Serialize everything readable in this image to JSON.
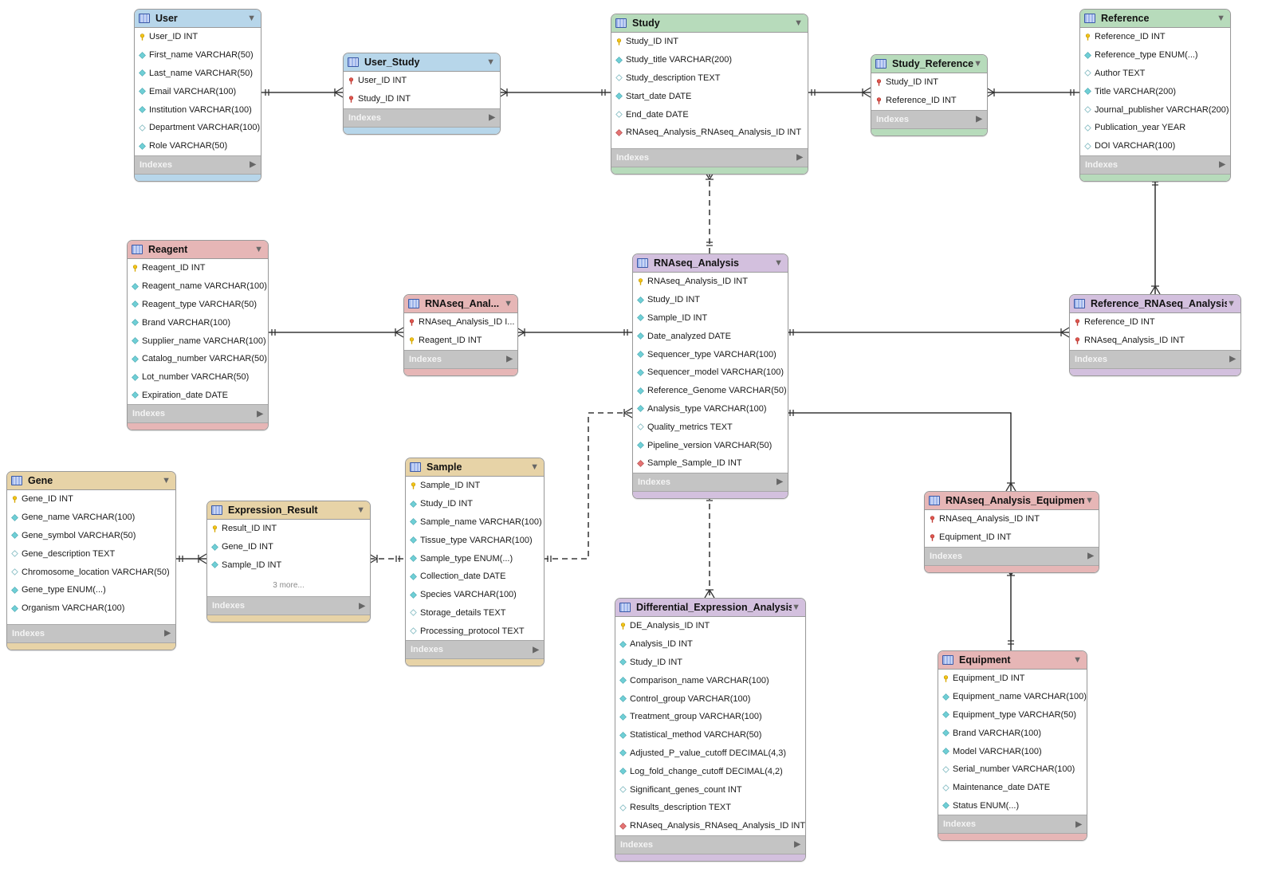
{
  "diagram": {
    "indexes_label": "Indexes",
    "colors": {
      "blue": "#b7d6ea",
      "green": "#b7dbbb",
      "red": "#e6b6b6",
      "purple": "#d3c0de",
      "tan": "#e7d3a7",
      "pk_key": "#f2c417",
      "fk_key": "#d9534f",
      "column_diamond": "#6fcfd6",
      "fk_diamond": "#e57373"
    },
    "tables": [
      {
        "id": "user",
        "name": "User",
        "color": "blue",
        "columns": [
          {
            "label": "User_ID INT",
            "icon": "primary-key"
          },
          {
            "label": "First_name VARCHAR(50)",
            "icon": "not-null-column"
          },
          {
            "label": "Last_name VARCHAR(50)",
            "icon": "not-null-column"
          },
          {
            "label": "Email VARCHAR(100)",
            "icon": "not-null-column"
          },
          {
            "label": "Institution VARCHAR(100)",
            "icon": "not-null-column"
          },
          {
            "label": "Department VARCHAR(100)",
            "icon": "nullable-column"
          },
          {
            "label": "Role VARCHAR(50)",
            "icon": "not-null-column"
          }
        ]
      },
      {
        "id": "user_study",
        "name": "User_Study",
        "color": "blue",
        "columns": [
          {
            "label": "User_ID INT",
            "icon": "foreign-primary-key"
          },
          {
            "label": "Study_ID INT",
            "icon": "foreign-primary-key"
          }
        ]
      },
      {
        "id": "study",
        "name": "Study",
        "color": "green",
        "columns": [
          {
            "label": "Study_ID INT",
            "icon": "primary-key"
          },
          {
            "label": "Study_title VARCHAR(200)",
            "icon": "not-null-column"
          },
          {
            "label": "Study_description TEXT",
            "icon": "nullable-column"
          },
          {
            "label": "Start_date DATE",
            "icon": "not-null-column"
          },
          {
            "label": "End_date DATE",
            "icon": "nullable-column"
          },
          {
            "label": "RNAseq_Analysis_RNAseq_Analysis_ID INT",
            "icon": "foreign-key-column"
          }
        ]
      },
      {
        "id": "study_reference",
        "name": "Study_Reference",
        "color": "green",
        "columns": [
          {
            "label": "Study_ID INT",
            "icon": "foreign-primary-key"
          },
          {
            "label": "Reference_ID INT",
            "icon": "foreign-primary-key"
          }
        ]
      },
      {
        "id": "reference",
        "name": "Reference",
        "color": "green",
        "columns": [
          {
            "label": "Reference_ID INT",
            "icon": "primary-key"
          },
          {
            "label": "Reference_type ENUM(...)",
            "icon": "not-null-column"
          },
          {
            "label": "Author TEXT",
            "icon": "nullable-column"
          },
          {
            "label": "Title VARCHAR(200)",
            "icon": "not-null-column"
          },
          {
            "label": "Journal_publisher VARCHAR(200)",
            "icon": "nullable-column"
          },
          {
            "label": "Publication_year YEAR",
            "icon": "nullable-column"
          },
          {
            "label": "DOI VARCHAR(100)",
            "icon": "nullable-column"
          }
        ]
      },
      {
        "id": "reagent",
        "name": "Reagent",
        "color": "red",
        "columns": [
          {
            "label": "Reagent_ID INT",
            "icon": "primary-key"
          },
          {
            "label": "Reagent_name VARCHAR(100)",
            "icon": "not-null-column"
          },
          {
            "label": "Reagent_type VARCHAR(50)",
            "icon": "not-null-column"
          },
          {
            "label": "Brand VARCHAR(100)",
            "icon": "not-null-column"
          },
          {
            "label": "Supplier_name VARCHAR(100)",
            "icon": "not-null-column"
          },
          {
            "label": "Catalog_number VARCHAR(50)",
            "icon": "not-null-column"
          },
          {
            "label": "Lot_number VARCHAR(50)",
            "icon": "not-null-column"
          },
          {
            "label": "Expiration_date DATE",
            "icon": "not-null-column"
          }
        ]
      },
      {
        "id": "rnaseq_reagent",
        "name": "RNAseq_Anal...",
        "color": "red",
        "columns": [
          {
            "label": "RNAseq_Analysis_ID I...",
            "icon": "foreign-primary-key"
          },
          {
            "label": "Reagent_ID INT",
            "icon": "primary-key"
          }
        ]
      },
      {
        "id": "rnaseq_analysis",
        "name": "RNAseq_Analysis",
        "color": "purple",
        "columns": [
          {
            "label": "RNAseq_Analysis_ID INT",
            "icon": "primary-key"
          },
          {
            "label": "Study_ID INT",
            "icon": "not-null-column"
          },
          {
            "label": "Sample_ID INT",
            "icon": "not-null-column"
          },
          {
            "label": "Date_analyzed DATE",
            "icon": "not-null-column"
          },
          {
            "label": "Sequencer_type VARCHAR(100)",
            "icon": "not-null-column"
          },
          {
            "label": "Sequencer_model VARCHAR(100)",
            "icon": "not-null-column"
          },
          {
            "label": "Reference_Genome VARCHAR(50)",
            "icon": "not-null-column"
          },
          {
            "label": "Analysis_type VARCHAR(100)",
            "icon": "not-null-column"
          },
          {
            "label": "Quality_metrics TEXT",
            "icon": "nullable-column"
          },
          {
            "label": "Pipeline_version VARCHAR(50)",
            "icon": "not-null-column"
          },
          {
            "label": "Sample_Sample_ID INT",
            "icon": "foreign-key-column"
          }
        ]
      },
      {
        "id": "reference_rnaseq",
        "name": "Reference_RNAseq_Analysis",
        "color": "purple",
        "columns": [
          {
            "label": "Reference_ID INT",
            "icon": "foreign-primary-key"
          },
          {
            "label": "RNAseq_Analysis_ID INT",
            "icon": "foreign-primary-key"
          }
        ]
      },
      {
        "id": "gene",
        "name": "Gene",
        "color": "tan",
        "columns": [
          {
            "label": "Gene_ID INT",
            "icon": "primary-key"
          },
          {
            "label": "Gene_name VARCHAR(100)",
            "icon": "not-null-column"
          },
          {
            "label": "Gene_symbol VARCHAR(50)",
            "icon": "not-null-column"
          },
          {
            "label": "Gene_description TEXT",
            "icon": "nullable-column"
          },
          {
            "label": "Chromosome_location VARCHAR(50)",
            "icon": "nullable-column"
          },
          {
            "label": "Gene_type ENUM(...)",
            "icon": "not-null-column"
          },
          {
            "label": "Organism VARCHAR(100)",
            "icon": "not-null-column"
          }
        ]
      },
      {
        "id": "expression_result",
        "name": "Expression_Result",
        "color": "tan",
        "more": "3 more...",
        "columns": [
          {
            "label": "Result_ID INT",
            "icon": "primary-key"
          },
          {
            "label": "Gene_ID INT",
            "icon": "not-null-column"
          },
          {
            "label": "Sample_ID INT",
            "icon": "not-null-column"
          }
        ]
      },
      {
        "id": "sample",
        "name": "Sample",
        "color": "tan",
        "columns": [
          {
            "label": "Sample_ID INT",
            "icon": "primary-key"
          },
          {
            "label": "Study_ID INT",
            "icon": "not-null-column"
          },
          {
            "label": "Sample_name VARCHAR(100)",
            "icon": "not-null-column"
          },
          {
            "label": "Tissue_type VARCHAR(100)",
            "icon": "not-null-column"
          },
          {
            "label": "Sample_type ENUM(...)",
            "icon": "not-null-column"
          },
          {
            "label": "Collection_date DATE",
            "icon": "not-null-column"
          },
          {
            "label": "Species VARCHAR(100)",
            "icon": "not-null-column"
          },
          {
            "label": "Storage_details TEXT",
            "icon": "nullable-column"
          },
          {
            "label": "Processing_protocol TEXT",
            "icon": "nullable-column"
          }
        ]
      },
      {
        "id": "de_analysis",
        "name": "Differential_Expression_Analysis",
        "color": "purple",
        "columns": [
          {
            "label": "DE_Analysis_ID INT",
            "icon": "primary-key"
          },
          {
            "label": "Analysis_ID INT",
            "icon": "not-null-column"
          },
          {
            "label": "Study_ID INT",
            "icon": "not-null-column"
          },
          {
            "label": "Comparison_name VARCHAR(100)",
            "icon": "not-null-column"
          },
          {
            "label": "Control_group VARCHAR(100)",
            "icon": "not-null-column"
          },
          {
            "label": "Treatment_group VARCHAR(100)",
            "icon": "not-null-column"
          },
          {
            "label": "Statistical_method VARCHAR(50)",
            "icon": "not-null-column"
          },
          {
            "label": "Adjusted_P_value_cutoff DECIMAL(4,3)",
            "icon": "not-null-column"
          },
          {
            "label": "Log_fold_change_cutoff DECIMAL(4,2)",
            "icon": "not-null-column"
          },
          {
            "label": "Significant_genes_count INT",
            "icon": "nullable-column"
          },
          {
            "label": "Results_description TEXT",
            "icon": "nullable-column"
          },
          {
            "label": "RNAseq_Analysis_RNAseq_Analysis_ID INT",
            "icon": "foreign-key-column"
          }
        ]
      },
      {
        "id": "rnaseq_equipment",
        "name": "RNAseq_Analysis_Equipment",
        "color": "red",
        "columns": [
          {
            "label": "RNAseq_Analysis_ID INT",
            "icon": "foreign-primary-key"
          },
          {
            "label": "Equipment_ID INT",
            "icon": "foreign-primary-key"
          }
        ]
      },
      {
        "id": "equipment",
        "name": "Equipment",
        "color": "red",
        "columns": [
          {
            "label": "Equipment_ID INT",
            "icon": "primary-key"
          },
          {
            "label": "Equipment_name VARCHAR(100)",
            "icon": "not-null-column"
          },
          {
            "label": "Equipment_type VARCHAR(50)",
            "icon": "not-null-column"
          },
          {
            "label": "Brand VARCHAR(100)",
            "icon": "not-null-column"
          },
          {
            "label": "Model VARCHAR(100)",
            "icon": "not-null-column"
          },
          {
            "label": "Serial_number VARCHAR(100)",
            "icon": "nullable-column"
          },
          {
            "label": "Maintenance_date DATE",
            "icon": "nullable-column"
          },
          {
            "label": "Status ENUM(...)",
            "icon": "not-null-column"
          }
        ]
      }
    ],
    "relationships": [
      {
        "from": "user",
        "to": "user_study",
        "from_card": "one",
        "to_card": "many",
        "style": "solid"
      },
      {
        "from": "study",
        "to": "user_study",
        "from_card": "one",
        "to_card": "many",
        "style": "solid"
      },
      {
        "from": "study",
        "to": "study_reference",
        "from_card": "one",
        "to_card": "many",
        "style": "solid"
      },
      {
        "from": "reference",
        "to": "study_reference",
        "from_card": "one",
        "to_card": "many",
        "style": "solid"
      },
      {
        "from": "rnaseq_analysis",
        "to": "study",
        "from_card": "one",
        "to_card": "many",
        "style": "dashed"
      },
      {
        "from": "reference",
        "to": "reference_rnaseq",
        "from_card": "one",
        "to_card": "many",
        "style": "solid"
      },
      {
        "from": "reagent",
        "to": "rnaseq_reagent",
        "from_card": "one",
        "to_card": "many",
        "style": "solid"
      },
      {
        "from": "rnaseq_analysis",
        "to": "rnaseq_reagent",
        "from_card": "one",
        "to_card": "many",
        "style": "solid"
      },
      {
        "from": "rnaseq_analysis",
        "to": "reference_rnaseq",
        "from_card": "one",
        "to_card": "many",
        "style": "solid"
      },
      {
        "from": "rnaseq_analysis",
        "to": "rnaseq_equipment",
        "from_card": "one",
        "to_card": "many",
        "style": "solid"
      },
      {
        "from": "equipment",
        "to": "rnaseq_equipment",
        "from_card": "one",
        "to_card": "many",
        "style": "solid"
      },
      {
        "from": "sample",
        "to": "rnaseq_analysis",
        "from_card": "one",
        "to_card": "many",
        "style": "dashed"
      },
      {
        "from": "rnaseq_analysis",
        "to": "de_analysis",
        "from_card": "one",
        "to_card": "many",
        "style": "dashed"
      },
      {
        "from": "gene",
        "to": "expression_result",
        "from_card": "one",
        "to_card": "many",
        "style": "solid"
      },
      {
        "from": "sample",
        "to": "expression_result",
        "from_card": "one",
        "to_card": "many",
        "style": "dashed"
      }
    ]
  }
}
